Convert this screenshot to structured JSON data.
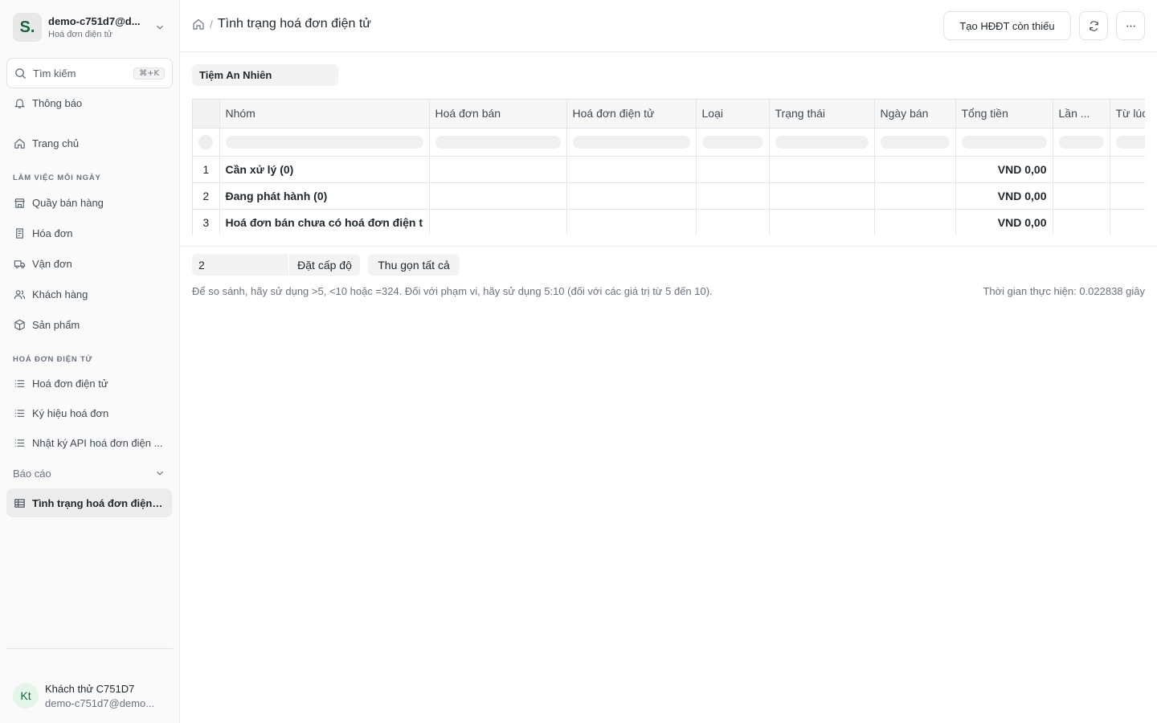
{
  "workspace": {
    "logo": "S.",
    "name": "demo-c751d7@d...",
    "subtitle": "Hoá đơn điện tử"
  },
  "search": {
    "label": "Tìm kiếm",
    "shortcut": "⌘+K"
  },
  "nav": {
    "notifications": "Thông báo",
    "home": "Trang chủ",
    "section_daily": "Làm việc mỗi ngày",
    "daily": [
      "Quầy bán hàng",
      "Hóa đơn",
      "Vận đơn",
      "Khách hàng",
      "Sản phẩm"
    ],
    "section_einvoice": "Hoá đơn điện tử",
    "einvoice": [
      "Hoá đơn điện tử",
      "Ký hiệu hoá đơn",
      "Nhật ký API hoá đơn điện ..."
    ],
    "reports_group": "Báo cáo",
    "active_report": "Tình trạng hoá đơn điện tử"
  },
  "user": {
    "initials": "Kt",
    "name": "Khách thử C751D7",
    "email": "demo-c751d7@demo..."
  },
  "header": {
    "page_title": "Tình trạng hoá đơn điện tử",
    "breadcrumb_sep": "/",
    "create_button": "Tạo HĐĐT còn thiếu"
  },
  "filter": {
    "company": "Tiệm An Nhiên"
  },
  "table": {
    "columns": [
      "Nhóm",
      "Hoá đơn bán",
      "Hoá đơn điện tử",
      "Loại",
      "Trạng thái",
      "Ngày bán",
      "Tổng tiền",
      "Lần ...",
      "Từ lúc"
    ],
    "rows": [
      {
        "no": "1",
        "group": "Cần xử lý (0)",
        "total": "VND 0,00"
      },
      {
        "no": "2",
        "group": "Đang phát hành (0)",
        "total": "VND 0,00"
      },
      {
        "no": "3",
        "group": "Hoá đơn bán chưa có hoá đơn điện t",
        "total": "VND 0,00"
      }
    ]
  },
  "footer": {
    "level_value": "2",
    "set_level_button": "Đặt cấp độ",
    "collapse_all_button": "Thu gọn tất cả",
    "hint": "Để so sánh, hãy sử dụng >5, <10 hoặc =324. Đối với phạm vi, hãy sử dụng 5:10 (đối với các giá trị từ 5 đến 10).",
    "exec_time": "Thời gian thực hiện: 0.022838 giây"
  },
  "colors": {
    "accent": "#15663f",
    "border": "#e2e2e2",
    "muted": "#6b7280"
  },
  "icons": [
    "search-icon",
    "bell-icon",
    "home-icon",
    "store-icon",
    "receipt-icon",
    "truck-icon",
    "users-icon",
    "box-icon",
    "list-icon",
    "chevron-down-icon",
    "table-icon",
    "refresh-icon",
    "more-icon"
  ]
}
